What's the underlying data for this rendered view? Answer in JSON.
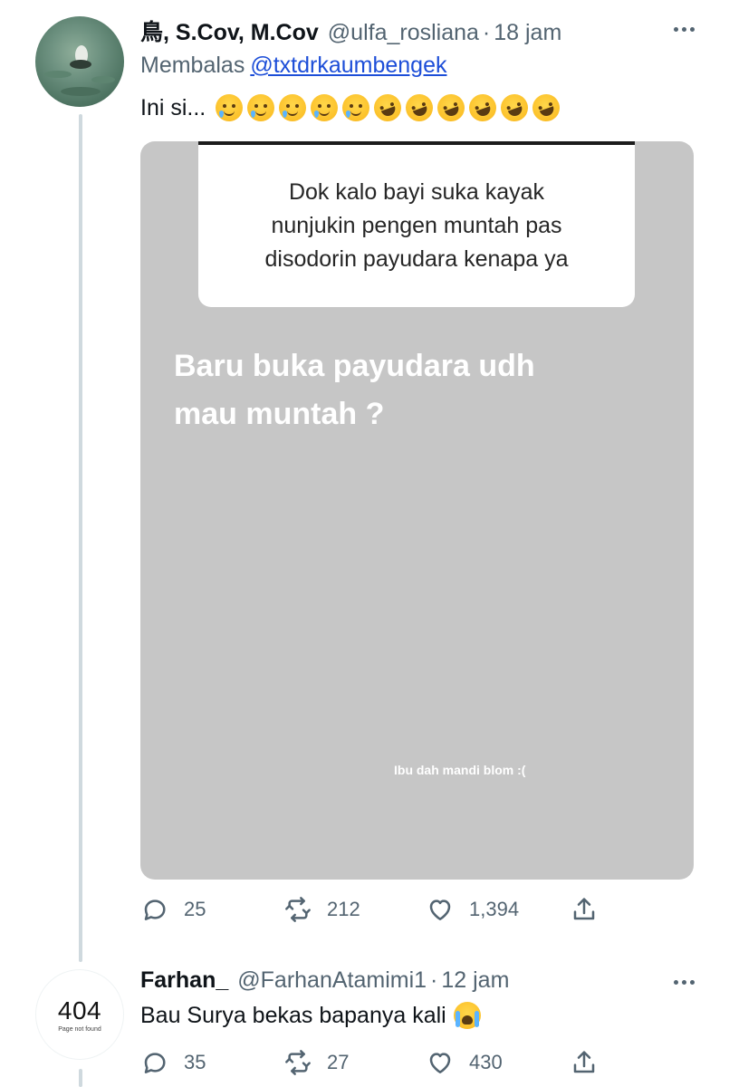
{
  "tweet1": {
    "display_name": "鳥, S.Cov, M.Cov",
    "handle": "@ulfa_rosliana",
    "separator": "·",
    "time": "18 jam",
    "reply_prefix": "Membalas",
    "reply_to": "@txtdrkaumbengek",
    "text": "Ini si...",
    "emoji": [
      "face-holding-back-tears",
      "face-holding-back-tears",
      "face-holding-back-tears",
      "face-holding-back-tears",
      "face-holding-back-tears",
      "rolling-on-the-floor-laughing",
      "rolling-on-the-floor-laughing",
      "rolling-on-the-floor-laughing",
      "rolling-on-the-floor-laughing",
      "rolling-on-the-floor-laughing",
      "rolling-on-the-floor-laughing"
    ],
    "media": {
      "question": "Dok kalo bayi suka kayak\nnunjukin pengen muntah pas\ndisodorin payudara kenapa ya",
      "answer": "Baru buka payudara udh\nmau muntah ?",
      "caption": "Ibu dah mandi blom :("
    },
    "actions": {
      "replies": "25",
      "retweets": "212",
      "likes": "1,394"
    }
  },
  "tweet2": {
    "display_name": "Farhan_",
    "handle": "@FarhanAtamimi1",
    "separator": "·",
    "time": "12 jam",
    "text": "Bau Surya bekas bapanya kali",
    "emoji": "loudly-crying-face",
    "avatar_text": "404",
    "avatar_subtext": "Page not found",
    "actions": {
      "replies": "35",
      "retweets": "27",
      "likes": "430"
    }
  },
  "colors": {
    "text": "#0f1419",
    "secondary": "#536471",
    "link": "#1d4ed8",
    "media_bg": "#c6c6c6",
    "thread_line": "#cfd9de"
  }
}
